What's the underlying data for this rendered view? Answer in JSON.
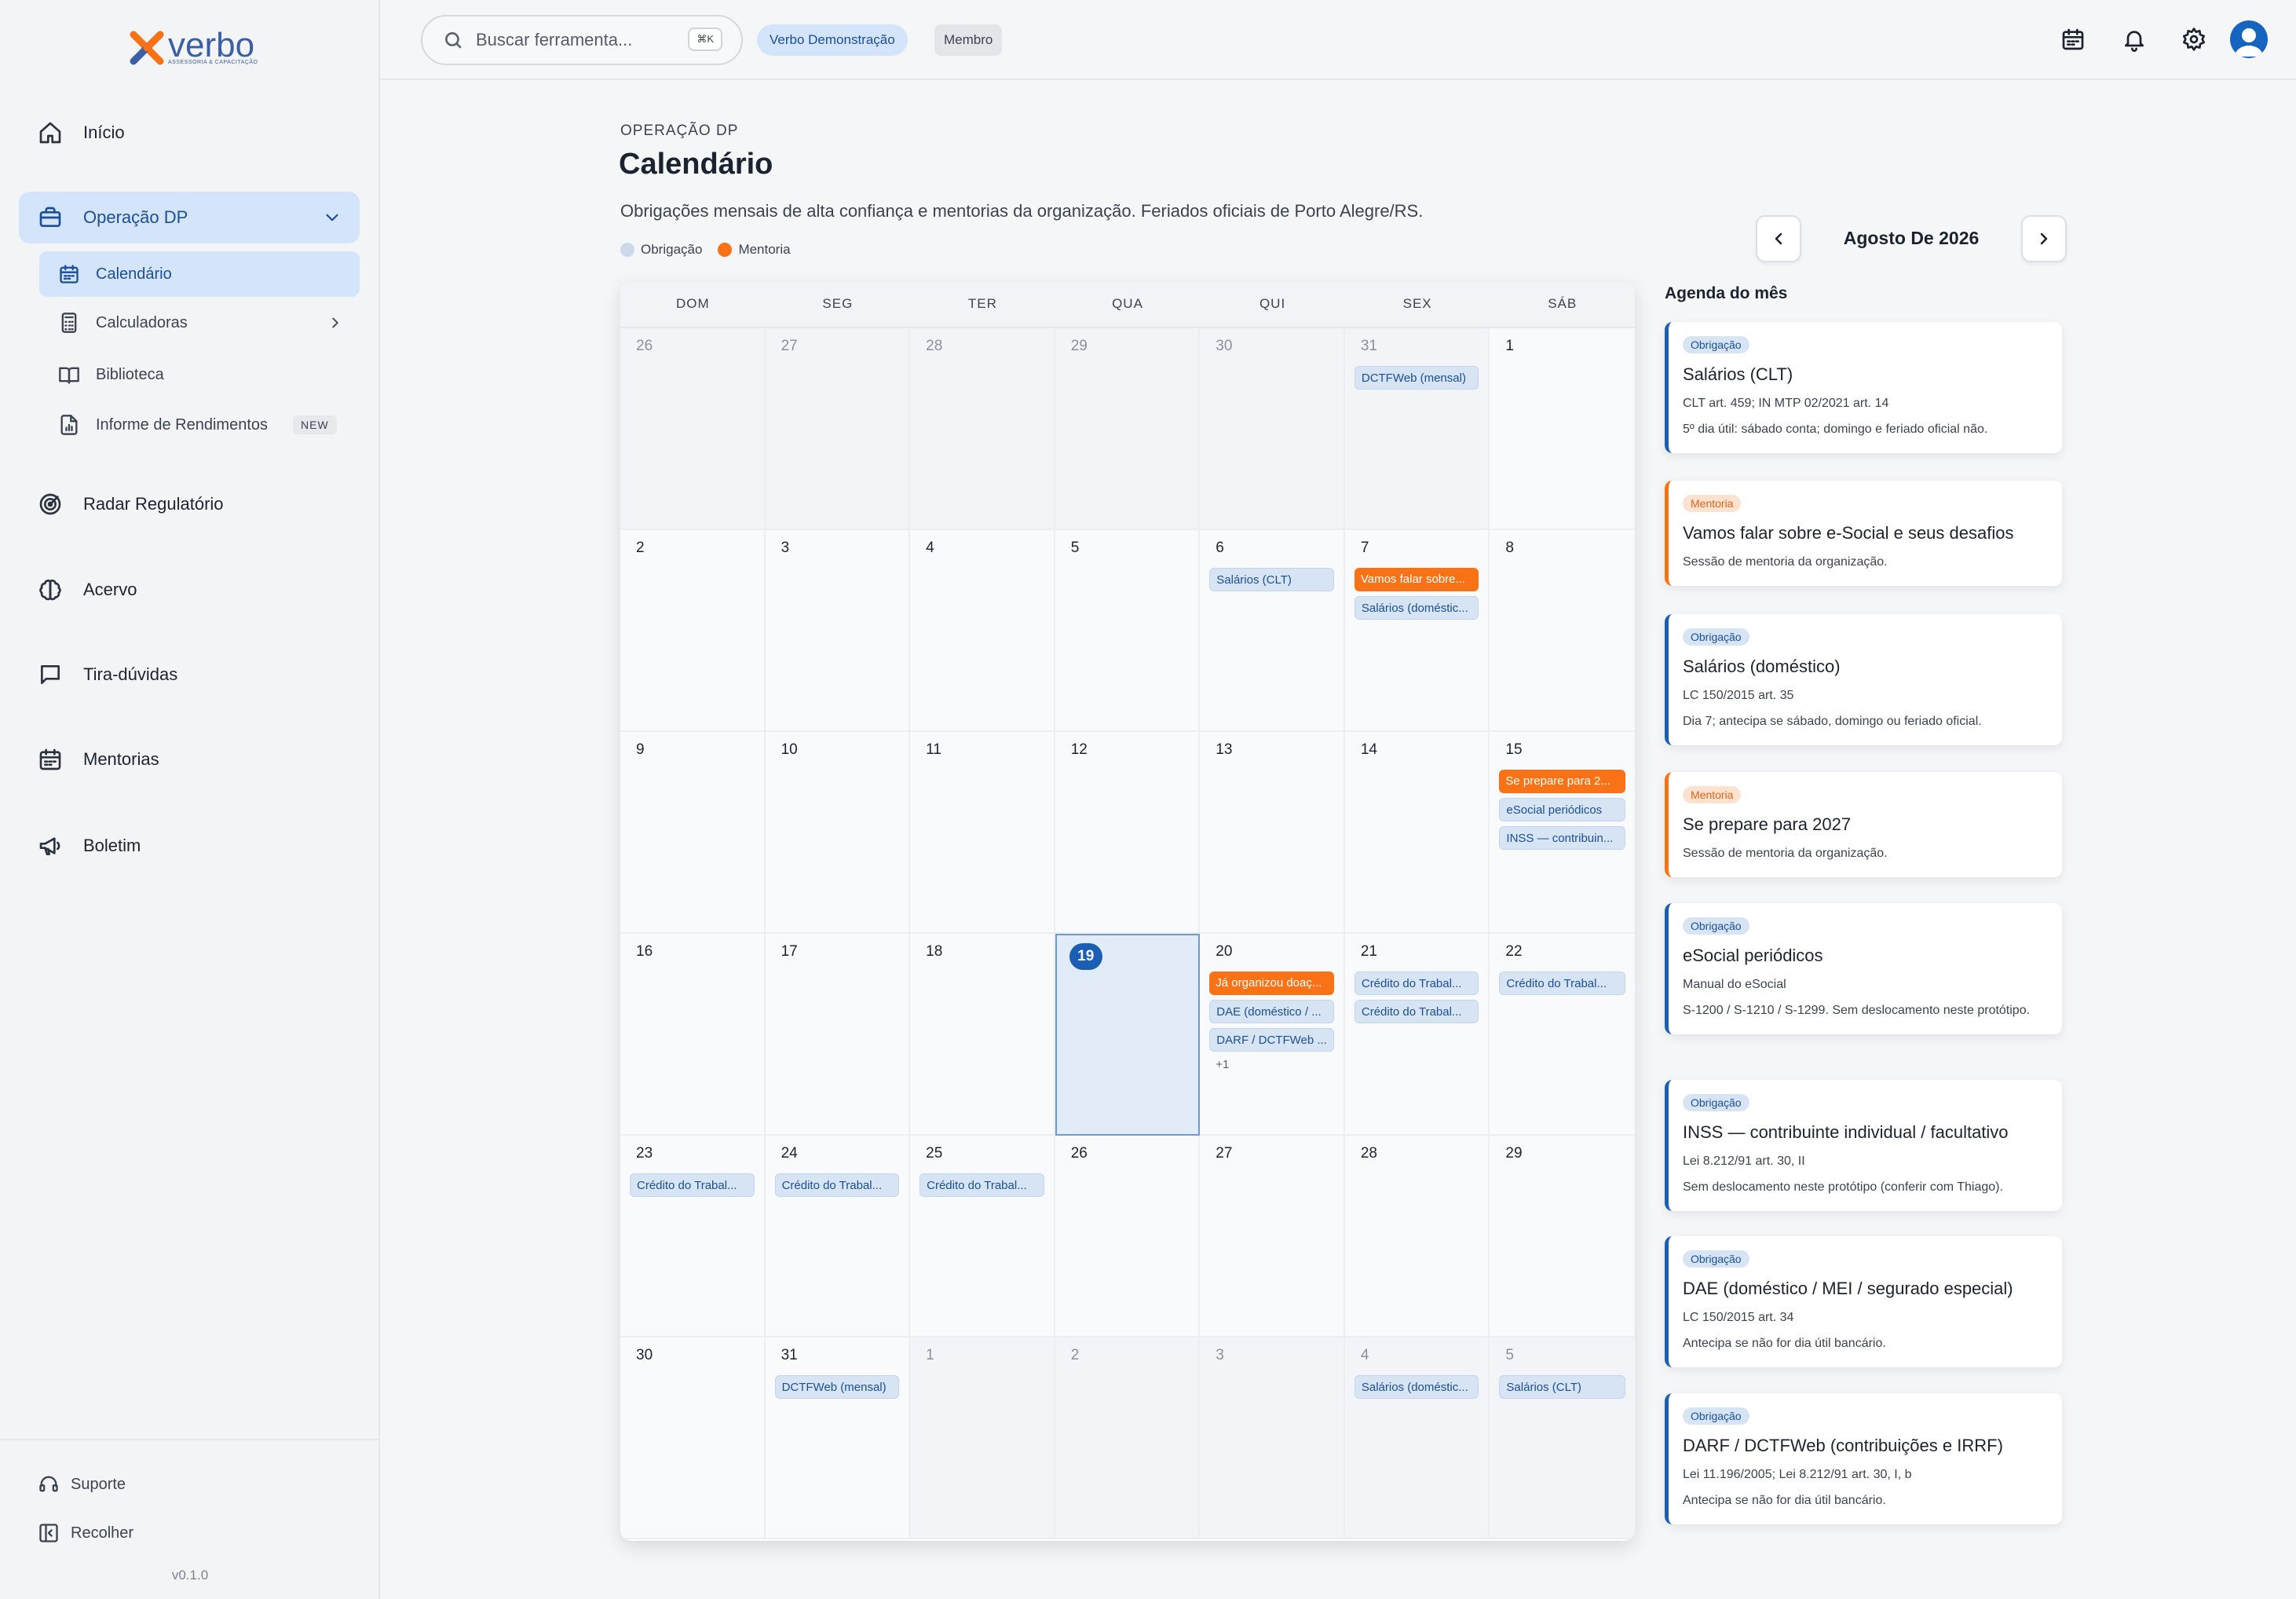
{
  "brand": {
    "name": "verbo",
    "subtitle": "ASSESSORIA & CAPACITAÇÃO",
    "accent": "#1b5fb4",
    "orange": "#f97316"
  },
  "sidebar": {
    "items": [
      {
        "label": "Início",
        "icon": "home-icon"
      },
      {
        "label": "Operação DP",
        "icon": "briefcase-icon"
      },
      {
        "label": "Radar Regulatório",
        "icon": "radar-icon"
      },
      {
        "label": "Acervo",
        "icon": "brain-icon"
      },
      {
        "label": "Tira-dúvidas",
        "icon": "chat-icon"
      },
      {
        "label": "Mentorias",
        "icon": "calendar-icon"
      },
      {
        "label": "Boletim",
        "icon": "megaphone-icon"
      }
    ],
    "sub_items": [
      {
        "label": "Calendário",
        "icon": "calendar-icon"
      },
      {
        "label": "Calculadoras",
        "icon": "calculator-icon"
      },
      {
        "label": "Biblioteca",
        "icon": "book-icon"
      },
      {
        "label": "Informe de Rendimentos",
        "icon": "document-icon",
        "badge": "NEW"
      }
    ],
    "footer": {
      "support": "Suporte",
      "collapse": "Recolher",
      "version": "v0.1.0"
    }
  },
  "topbar": {
    "search_placeholder": "Buscar ferramenta...",
    "shortcut": "⌘K",
    "org": "Verbo Demonstração",
    "role": "Membro"
  },
  "page": {
    "eyebrow": "OPERAÇÃO DP",
    "title": "Calendário",
    "description": "Obrigações mensais de alta confiança e mentorias da organização. Feriados oficiais de Porto Alegre/RS.",
    "legend": [
      {
        "label": "Obrigação",
        "color": "#cdd9ea"
      },
      {
        "label": "Mentoria",
        "color": "#f97316"
      }
    ]
  },
  "calendar": {
    "weekdays": [
      "DOM",
      "SEG",
      "TER",
      "QUA",
      "QUI",
      "SEX",
      "SÁB"
    ],
    "days": [
      {
        "n": "26",
        "out": true,
        "events": []
      },
      {
        "n": "27",
        "out": true,
        "events": []
      },
      {
        "n": "28",
        "out": true,
        "events": []
      },
      {
        "n": "29",
        "out": true,
        "events": []
      },
      {
        "n": "30",
        "out": true,
        "events": []
      },
      {
        "n": "31",
        "out": true,
        "events": [
          {
            "t": "DCTFWeb (mensal)",
            "k": "obr"
          }
        ]
      },
      {
        "n": "1",
        "events": []
      },
      {
        "n": "2",
        "events": []
      },
      {
        "n": "3",
        "events": []
      },
      {
        "n": "4",
        "events": []
      },
      {
        "n": "5",
        "events": []
      },
      {
        "n": "6",
        "events": [
          {
            "t": "Salários (CLT)",
            "k": "obr"
          }
        ]
      },
      {
        "n": "7",
        "events": [
          {
            "t": "Vamos falar sobre...",
            "k": "men"
          },
          {
            "t": "Salários (doméstic...",
            "k": "obr"
          }
        ]
      },
      {
        "n": "8",
        "events": []
      },
      {
        "n": "9",
        "events": []
      },
      {
        "n": "10",
        "events": []
      },
      {
        "n": "11",
        "events": []
      },
      {
        "n": "12",
        "events": []
      },
      {
        "n": "13",
        "events": []
      },
      {
        "n": "14",
        "events": []
      },
      {
        "n": "15",
        "events": [
          {
            "t": "Se prepare para 2...",
            "k": "men"
          },
          {
            "t": "eSocial periódicos",
            "k": "obr"
          },
          {
            "t": "INSS — contribuin...",
            "k": "obr"
          }
        ]
      },
      {
        "n": "16",
        "events": []
      },
      {
        "n": "17",
        "events": []
      },
      {
        "n": "18",
        "events": []
      },
      {
        "n": "19",
        "today": true,
        "events": []
      },
      {
        "n": "20",
        "events": [
          {
            "t": "Já organizou doaç...",
            "k": "men"
          },
          {
            "t": "DAE (doméstico / ...",
            "k": "obr"
          },
          {
            "t": "DARF / DCTFWeb ...",
            "k": "obr"
          }
        ],
        "more": "+1"
      },
      {
        "n": "21",
        "events": [
          {
            "t": "Crédito do Trabal...",
            "k": "obr"
          },
          {
            "t": "Crédito do Trabal...",
            "k": "obr"
          }
        ]
      },
      {
        "n": "22",
        "events": [
          {
            "t": "Crédito do Trabal...",
            "k": "obr"
          }
        ]
      },
      {
        "n": "23",
        "events": [
          {
            "t": "Crédito do Trabal...",
            "k": "obr"
          }
        ]
      },
      {
        "n": "24",
        "events": [
          {
            "t": "Crédito do Trabal...",
            "k": "obr"
          }
        ]
      },
      {
        "n": "25",
        "events": [
          {
            "t": "Crédito do Trabal...",
            "k": "obr"
          }
        ]
      },
      {
        "n": "26",
        "events": []
      },
      {
        "n": "27",
        "events": []
      },
      {
        "n": "28",
        "events": []
      },
      {
        "n": "29",
        "events": []
      },
      {
        "n": "30",
        "events": []
      },
      {
        "n": "31",
        "events": [
          {
            "t": "DCTFWeb (mensal)",
            "k": "obr"
          }
        ]
      },
      {
        "n": "1",
        "out": true,
        "events": []
      },
      {
        "n": "2",
        "out": true,
        "events": []
      },
      {
        "n": "3",
        "out": true,
        "events": []
      },
      {
        "n": "4",
        "out": true,
        "events": [
          {
            "t": "Salários (doméstic...",
            "k": "obr"
          }
        ]
      },
      {
        "n": "5",
        "out": true,
        "events": [
          {
            "t": "Salários (CLT)",
            "k": "obr"
          }
        ]
      }
    ]
  },
  "agenda": {
    "month": "Agosto De 2026",
    "title": "Agenda do mês",
    "cards": [
      {
        "tag": "Obrigação",
        "kind": "obr",
        "title": "Salários (CLT)",
        "line1": "CLT art. 459; IN MTP 02/2021 art. 14",
        "line2": "5º dia útil: sábado conta; domingo e feriado oficial não."
      },
      {
        "tag": "Mentoria",
        "kind": "men",
        "title": "Vamos falar sobre e-Social e seus desafios",
        "line1": "Sessão de mentoria da organização.",
        "line2": ""
      },
      {
        "tag": "Obrigação",
        "kind": "obr",
        "title": "Salários (doméstico)",
        "line1": "LC 150/2015 art. 35",
        "line2": "Dia 7; antecipa se sábado, domingo ou feriado oficial."
      },
      {
        "tag": "Mentoria",
        "kind": "men",
        "title": "Se prepare para 2027",
        "line1": "Sessão de mentoria da organização.",
        "line2": ""
      },
      {
        "tag": "Obrigação",
        "kind": "obr",
        "title": "eSocial periódicos",
        "line1": "Manual do eSocial",
        "line2": "S-1200 / S-1210 / S-1299. Sem deslocamento neste protótipo."
      },
      {
        "tag": "Obrigação",
        "kind": "obr",
        "title": "INSS — contribuinte individual / facultativo",
        "line1": "Lei 8.212/91 art. 30, II",
        "line2": "Sem deslocamento neste protótipo (conferir com Thiago)."
      },
      {
        "tag": "Obrigação",
        "kind": "obr",
        "title": "DAE (doméstico / MEI / segurado especial)",
        "line1": "LC 150/2015 art. 34",
        "line2": "Antecipa se não for dia útil bancário."
      },
      {
        "tag": "Obrigação",
        "kind": "obr",
        "title": "DARF / DCTFWeb (contribuições e IRRF)",
        "line1": "Lei 11.196/2005; Lei 8.212/91 art. 30, I, b",
        "line2": "Antecipa se não for dia útil bancário."
      }
    ]
  }
}
